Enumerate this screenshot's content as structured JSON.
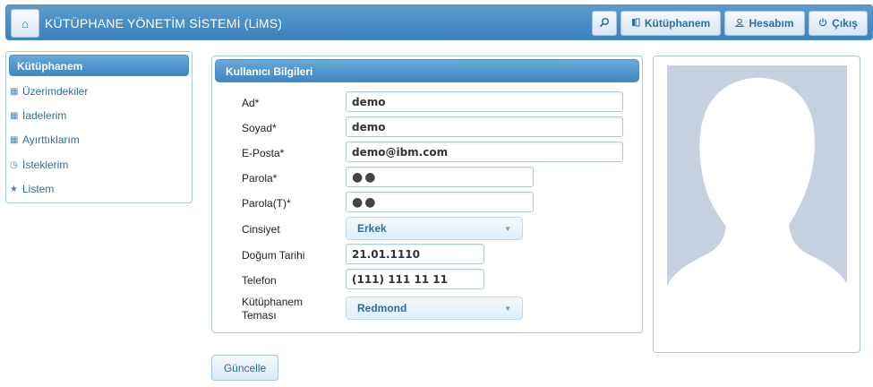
{
  "header": {
    "title": "KÜTÜPHANE YÖNETİM SİSTEMİ (LiMS)",
    "home_icon": "home-icon",
    "buttons": {
      "search_icon": "search-icon",
      "library_label": "Kütüphanem",
      "account_label": "Hesabım",
      "logout_label": "Çıkış"
    }
  },
  "sidebar": {
    "title": "Kütüphanem",
    "items": [
      {
        "label": "Üzerimdekiler",
        "icon": "grid-icon"
      },
      {
        "label": "İadelerim",
        "icon": "grid-icon"
      },
      {
        "label": "Ayırttıklarım",
        "icon": "grid-icon"
      },
      {
        "label": "İsteklerim",
        "icon": "clock-icon"
      },
      {
        "label": "Listem",
        "icon": "star-icon"
      }
    ]
  },
  "panel": {
    "title": "Kullanıcı Bilgileri",
    "fields": {
      "ad": {
        "label": "Ad*",
        "value": "demo"
      },
      "soyad": {
        "label": "Soyad*",
        "value": "demo"
      },
      "eposta": {
        "label": "E-Posta*",
        "value": "demo@ibm.com"
      },
      "parola": {
        "label": "Parola*",
        "value": "●●"
      },
      "parola_t": {
        "label": "Parola(T)*",
        "value": "●●"
      },
      "cinsiyet": {
        "label": "Cinsiyet",
        "value": "Erkek"
      },
      "dogum": {
        "label": "Doğum Tarihi",
        "value": "21.01.1110"
      },
      "telefon": {
        "label": "Telefon",
        "value": "(111) 111 11 11"
      },
      "tema": {
        "label_line1": "Kütüphanem",
        "label_line2": "Teması",
        "value": "Redmond"
      }
    }
  },
  "actions": {
    "update_label": "Güncelle"
  },
  "colors": {
    "header_blue": "#4a8ec6",
    "link_blue": "#2e6e9e",
    "avatar_bg": "#c7d0df"
  }
}
